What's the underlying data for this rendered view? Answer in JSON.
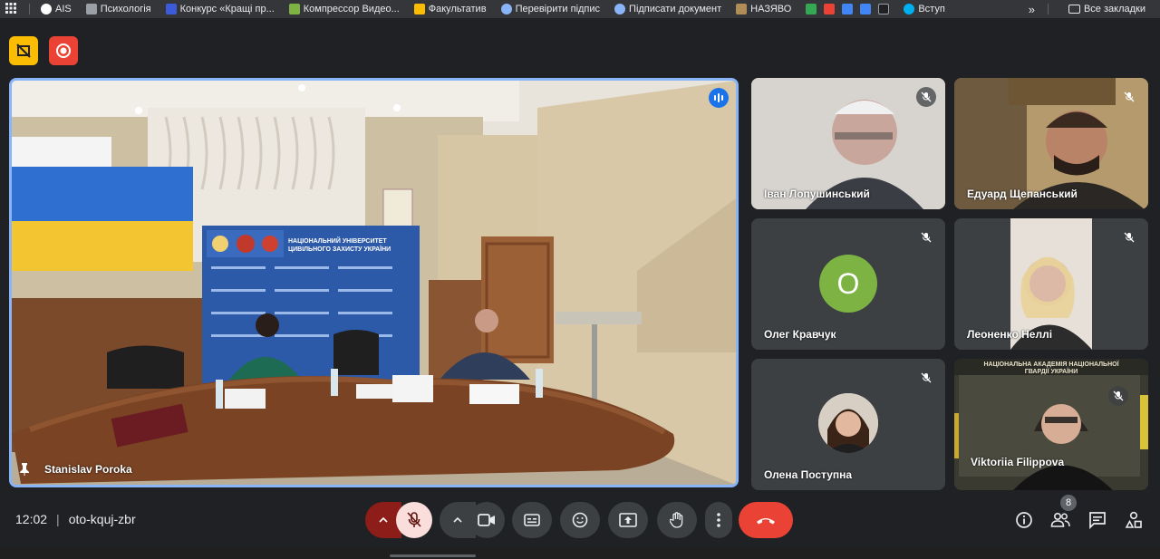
{
  "bookmarks": {
    "items": [
      {
        "label": "AIS",
        "icon": "ais-icon",
        "color": "#ffffff"
      },
      {
        "label": "Психологія",
        "icon": "folder-icon",
        "color": "#9aa0a6"
      },
      {
        "label": "Конкурс «Кращі пр...",
        "icon": "trident-icon",
        "color": "#3b5bdb"
      },
      {
        "label": "Компрессор Видео...",
        "icon": "v-icon",
        "color": "#7cb342"
      },
      {
        "label": "Факультатив",
        "icon": "drive-icon",
        "color": "#fbbc04"
      },
      {
        "label": "Перевірити підпис",
        "icon": "globe-icon",
        "color": "#8ab4f8"
      },
      {
        "label": "Підписати документ",
        "icon": "globe-icon",
        "color": "#8ab4f8"
      },
      {
        "label": "НАЗЯВО",
        "icon": "naqa-icon",
        "color": "#b08d57"
      },
      {
        "label": "Вступ",
        "icon": "skype-icon",
        "color": "#00aff0"
      }
    ],
    "all_bookmarks": "Все закладки"
  },
  "main": {
    "speaker_name": "Stanislav Poroka",
    "banner_text": "НАЦІОНАЛЬНИЙ УНІВЕРСИТЕТ ЦИВІЛЬНОГО ЗАХИСТУ УКРАЇНИ"
  },
  "participants": [
    {
      "name": "Іван Лопушинський",
      "type": "video"
    },
    {
      "name": "Едуард Щепанський",
      "type": "video"
    },
    {
      "name": "Олег Кравчук",
      "type": "avatar",
      "initial": "О",
      "avatar_color": "#7cb342"
    },
    {
      "name": "Леоненко Неллі",
      "type": "video"
    },
    {
      "name": "Олена Поступна",
      "type": "photo"
    },
    {
      "name": "Viktoriia Filippova",
      "type": "video",
      "overlay_text": "НАЦІОНАЛЬНА АКАДЕМІЯ НАЦІОНАЛЬНОЇ ГВАРДІЇ УКРАЇНИ"
    }
  ],
  "meeting": {
    "time": "12:02",
    "separator": "|",
    "code": "oto-kquj-zbr",
    "participant_count": "8"
  },
  "colors": {
    "accent": "#8ab4f8",
    "end_call": "#ea4335",
    "mic_off_bg": "#f9dedc",
    "mic_chevron_bg": "#8c1d18",
    "record": "#ea4335",
    "recording_badge": "#fbbc04"
  }
}
